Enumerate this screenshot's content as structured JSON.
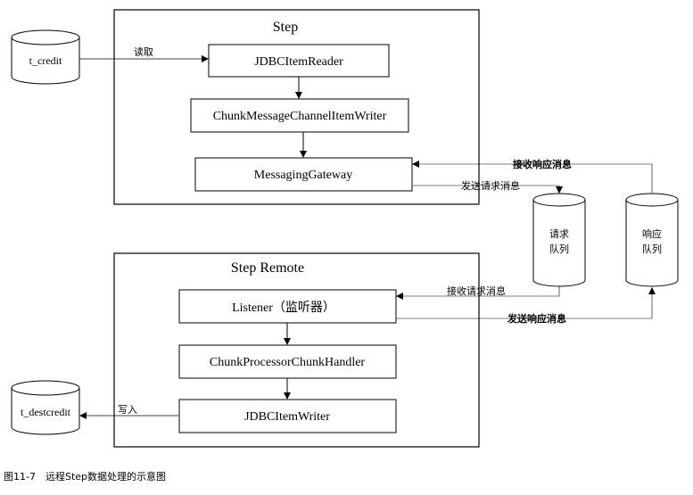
{
  "diagram": {
    "step_box": {
      "title": "Step"
    },
    "remote_box": {
      "title": "Step Remote"
    },
    "components": {
      "reader": "JDBCItemReader",
      "channel_writer": "ChunkMessageChannelItemWriter",
      "gateway": "MessagingGateway",
      "listener": "Listener（监听器）",
      "handler": "ChunkProcessorChunkHandler",
      "jdbc_writer": "JDBCItemWriter"
    },
    "databases": {
      "source": "t_credit",
      "dest": "t_destcredit"
    },
    "queues": {
      "request": {
        "line1": "请求",
        "line2": "队列"
      },
      "response": {
        "line1": "响应",
        "line2": "队列"
      }
    },
    "edge_labels": {
      "read": "读取",
      "write": "写入",
      "receive_response": "接收响应消息",
      "send_request": "发送请求消息",
      "receive_request": "接收请求消息",
      "send_response": "发送响应消息"
    },
    "caption": "图11-7　远程Step数据处理的示意图"
  }
}
